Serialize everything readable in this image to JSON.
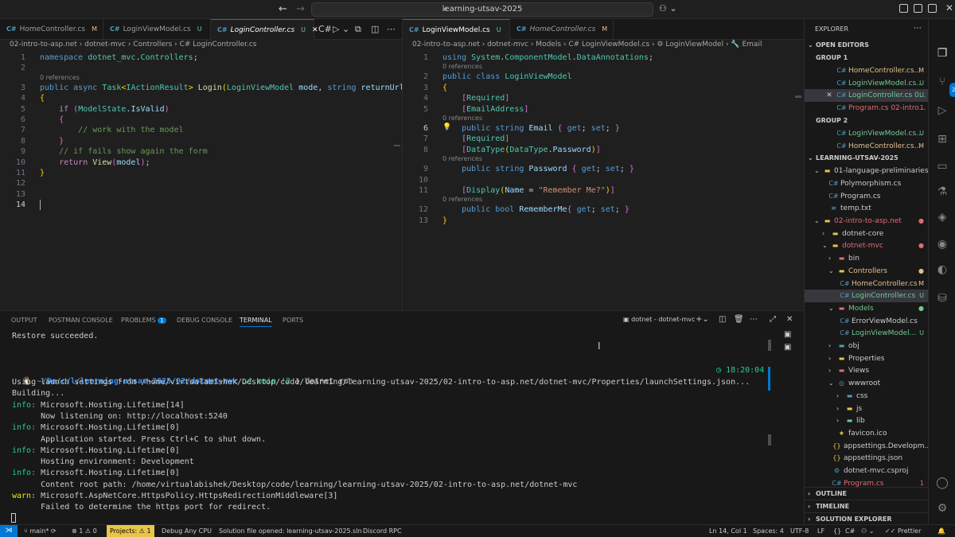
{
  "window": {
    "search": "learning-utsav-2025"
  },
  "left_editor": {
    "tabs": [
      {
        "label": "HomeController.cs",
        "mark": "M"
      },
      {
        "label": "LoginViewModel.cs",
        "mark": "U"
      },
      {
        "label": "LoginController.cs",
        "mark": "U"
      }
    ],
    "breadcrumb": "02-intro-to-asp.net  ›  dotnet-mvc  ›  Controllers  ›  C# LoginController.cs",
    "lines": [
      {
        "n": "1",
        "html": "<span class=\"kw\">namespace</span> <span class=\"ty\">dotnet_mvc</span>.<span class=\"ty\">Controllers</span>;"
      },
      {
        "n": "2",
        "html": ""
      },
      {
        "n": "3",
        "html": "<span class=\"kw\">public</span> <span class=\"kw\">async</span> <span class=\"ty\">Task</span><span class=\"br\">&lt;</span><span class=\"ty\">IActionResult</span><span class=\"br\">&gt;</span> <span class=\"fn\">Login</span><span class=\"br\">(</span><span class=\"ty\">LoginViewModel</span> <span class=\"pl\">mode</span>, <span class=\"kw\">string</span> <span class=\"pl\">returnUrl</span>"
      },
      {
        "n": "4",
        "html": "<span class=\"br\">{</span>"
      },
      {
        "n": "5",
        "html": "    <span class=\"ctl\">if</span> <span class=\"br2\">(</span><span class=\"ty\">ModelState</span>.<span class=\"pl\">IsValid</span><span class=\"br2\">)</span>"
      },
      {
        "n": "6",
        "html": "    <span class=\"br2\">{</span>"
      },
      {
        "n": "7",
        "html": "        <span class=\"cm\">// work with the model</span>"
      },
      {
        "n": "8",
        "html": "    <span class=\"br2\">}</span>"
      },
      {
        "n": "9",
        "html": "    <span class=\"cm\">// if fails show again the form</span>"
      },
      {
        "n": "10",
        "html": "    <span class=\"ctl\">return</span> <span class=\"fn\">View</span><span class=\"br2\">(</span><span class=\"pl\">model</span><span class=\"br2\">)</span>;"
      },
      {
        "n": "11",
        "html": "<span class=\"br\">}</span>"
      },
      {
        "n": "12",
        "html": ""
      },
      {
        "n": "13",
        "html": ""
      },
      {
        "n": "14",
        "html": ""
      }
    ],
    "lens": "0 references"
  },
  "right_editor": {
    "tabs": [
      {
        "label": "LoginViewModel.cs",
        "mark": "U"
      },
      {
        "label": "HomeController.cs",
        "mark": "M"
      }
    ],
    "breadcrumb": "02-intro-to-asp.net  ›  dotnet-mvc  ›  Models  ›  C# LoginViewModel.cs  ›  ⚙ LoginViewModel  ›  🔧 Email",
    "lines": [
      {
        "n": "1",
        "html": "<span class=\"kw\">using</span> <span class=\"ty\">System</span>.<span class=\"ty\">ComponentModel</span>.<span class=\"ty\">DataAnnotations</span>;"
      },
      {
        "n": "2",
        "html": "<span class=\"kw\">public</span> <span class=\"kw\">class</span> <span class=\"ty\">LoginViewModel</span>"
      },
      {
        "n": "3",
        "html": "<span class=\"br\">{</span>"
      },
      {
        "n": "4",
        "html": "    <span class=\"br2\">[</span><span class=\"at\">Required</span><span class=\"br2\">]</span>"
      },
      {
        "n": "5",
        "html": "    <span class=\"br2\">[</span><span class=\"at\">EmailAddress</span><span class=\"br2\">]</span>"
      },
      {
        "n": "6",
        "html": "    <span class=\"kw\">public</span> <span class=\"kw\">string</span> <span class=\"pl\">Email</span> <span class=\"br2\">{</span> <span class=\"kw\">get</span>; <span class=\"kw\">set</span>; <span class=\"br2\">}</span>"
      },
      {
        "n": "7",
        "html": "    <span class=\"br2\">[</span><span class=\"at\">Required</span><span class=\"br2\">]</span>"
      },
      {
        "n": "8",
        "html": "    <span class=\"br2\">[</span><span class=\"at\">DataType</span><span class=\"br\">(</span><span class=\"ty\">DataType</span>.<span class=\"pl\">Password</span><span class=\"br\">)</span><span class=\"br2\">]</span>"
      },
      {
        "n": "9",
        "html": "    <span class=\"kw\">public</span> <span class=\"kw\">string</span> <span class=\"pl\">Password</span> <span class=\"br2\">{</span> <span class=\"kw\">get</span>; <span class=\"kw\">set</span>; <span class=\"br2\">}</span>"
      },
      {
        "n": "10",
        "html": ""
      },
      {
        "n": "11",
        "html": "    <span class=\"br2\">[</span><span class=\"at\">Display</span><span class=\"br\">(</span><span class=\"pl\">Name</span> = <span class=\"st\">\"Remember Me?\"</span><span class=\"br\">)</span><span class=\"br2\">]</span>"
      },
      {
        "n": "12",
        "html": "    <span class=\"kw\">public</span> <span class=\"kw\">bool</span> <span class=\"pl\">RememberMe</span><span class=\"br2\">{</span> <span class=\"kw\">get</span>; <span class=\"kw\">set</span>; <span class=\"br2\">}</span>"
      },
      {
        "n": "13",
        "html": "<span class=\"br\">}</span>"
      }
    ],
    "lens": "0 references"
  },
  "explorer": {
    "title": "EXPLORER",
    "open_editors": "OPEN EDITORS",
    "group1": "GROUP 1",
    "group2": "GROUP 2",
    "workspace": "LEARNING-UTSAV-2025",
    "rows": [
      {
        "kind": "file",
        "indent": 40,
        "icon": "C#",
        "label": "HomeController.cs...",
        "stat": "M",
        "cls": "c-mod",
        "lcls": "c-mod"
      },
      {
        "kind": "file",
        "indent": 40,
        "icon": "C#",
        "label": "LoginViewModel.cs...",
        "stat": "U",
        "cls": "c-grn",
        "lcls": "c-grn"
      },
      {
        "kind": "file",
        "indent": 40,
        "icon": "C#",
        "label": "LoginController.cs 0...",
        "stat": "U",
        "cls": "c-grn",
        "lcls": "c-grn",
        "sel": true,
        "close": true
      },
      {
        "kind": "file",
        "indent": 40,
        "icon": "C#",
        "label": "Program.cs  02-intro...",
        "stat": "1",
        "cls": "c-red",
        "lcls": "c-red"
      },
      {
        "kind": "grp2"
      },
      {
        "kind": "file",
        "indent": 40,
        "icon": "C#",
        "label": "LoginViewModel.cs...",
        "stat": "U",
        "cls": "c-grn",
        "lcls": "c-grn"
      },
      {
        "kind": "file",
        "indent": 40,
        "icon": "C#",
        "label": "HomeController.cs...",
        "stat": "M",
        "cls": "c-mod",
        "lcls": "c-mod"
      },
      {
        "kind": "ws"
      },
      {
        "kind": "folder",
        "indent": 12,
        "chev": "⌄",
        "icon": "▬",
        "icls": "c-yel",
        "label": "01-language-preliminaries"
      },
      {
        "kind": "file",
        "indent": 30,
        "icon": "C#",
        "label": "Polymorphism.cs"
      },
      {
        "kind": "file",
        "indent": 30,
        "icon": "C#",
        "label": "Program.cs"
      },
      {
        "kind": "file",
        "indent": 30,
        "icon": "≡",
        "icls": "c-blue",
        "label": "temp.txt"
      },
      {
        "kind": "folder",
        "indent": 12,
        "chev": "⌄",
        "icon": "▬",
        "icls": "c-yel",
        "label": "02-intro-to-asp.net",
        "lcls": "c-red",
        "dot": true
      },
      {
        "kind": "folder",
        "indent": 22,
        "chev": "›",
        "icon": "▬",
        "icls": "c-yel",
        "label": "dotnet-core"
      },
      {
        "kind": "folder",
        "indent": 22,
        "chev": "⌄",
        "icon": "▬",
        "icls": "c-yel",
        "label": "dotnet-mvc",
        "lcls": "c-red",
        "dot": true
      },
      {
        "kind": "folder",
        "indent": 30,
        "chev": "›",
        "icon": "▬",
        "icls": "c-red",
        "label": "bin"
      },
      {
        "kind": "folder",
        "indent": 30,
        "chev": "⌄",
        "icon": "▬",
        "icls": "c-yel",
        "label": "Controllers",
        "lcls": "c-mod",
        "dot": true
      },
      {
        "kind": "file",
        "indent": 44,
        "icon": "C#",
        "label": "HomeController.cs",
        "stat": "M",
        "cls": "c-mod",
        "lcls": "c-mod"
      },
      {
        "kind": "file",
        "indent": 44,
        "icon": "C#",
        "label": "LoginController.cs",
        "stat": "U",
        "cls": "c-grn",
        "lcls": "c-grn",
        "sel": true
      },
      {
        "kind": "folder",
        "indent": 30,
        "chev": "⌄",
        "icon": "▬",
        "icls": "c-red",
        "label": "Models",
        "lcls": "c-grn",
        "dot": true
      },
      {
        "kind": "file",
        "indent": 44,
        "icon": "C#",
        "label": "ErrorViewModel.cs"
      },
      {
        "kind": "file",
        "indent": 44,
        "icon": "C#",
        "label": "LoginViewModel...",
        "stat": "U",
        "cls": "c-grn",
        "lcls": "c-grn"
      },
      {
        "kind": "folder",
        "indent": 30,
        "chev": "›",
        "icon": "▬",
        "icls": "c-blue",
        "label": "obj"
      },
      {
        "kind": "folder",
        "indent": 30,
        "chev": "›",
        "icon": "▬",
        "icls": "c-yel",
        "label": "Properties"
      },
      {
        "kind": "folder",
        "indent": 30,
        "chev": "›",
        "icon": "▬",
        "icls": "c-red",
        "label": "Views"
      },
      {
        "kind": "folder",
        "indent": 30,
        "chev": "⌄",
        "icon": "◎",
        "icls": "c-blue",
        "label": "wwwroot"
      },
      {
        "kind": "folder",
        "indent": 40,
        "chev": "›",
        "icon": "▬",
        "icls": "c-blue",
        "label": "css"
      },
      {
        "kind": "folder",
        "indent": 40,
        "chev": "›",
        "icon": "▬",
        "icls": "c-yel",
        "label": "js"
      },
      {
        "kind": "folder",
        "indent": 40,
        "chev": "›",
        "icon": "▬",
        "icls": "c-grn",
        "label": "lib"
      },
      {
        "kind": "file",
        "indent": 40,
        "icon": "★",
        "icls": "c-yel",
        "label": "favicon.ico"
      },
      {
        "kind": "file",
        "indent": 34,
        "icon": "{}",
        "icls": "c-yel",
        "label": "appsettings.Developm..."
      },
      {
        "kind": "file",
        "indent": 34,
        "icon": "{}",
        "icls": "c-yel",
        "label": "appsettings.json"
      },
      {
        "kind": "file",
        "indent": 34,
        "icon": "⚙",
        "icls": "c-blue",
        "label": "dotnet-mvc.csproj"
      },
      {
        "kind": "file",
        "indent": 34,
        "icon": "C#",
        "label": "Program.cs",
        "stat": "1",
        "cls": "c-red",
        "lcls": "c-red"
      }
    ],
    "outline": "OUTLINE",
    "timeline": "TIMELINE",
    "solution_explorer": "SOLUTION EXPLORER"
  },
  "panel": {
    "tabs": [
      "OUTPUT",
      "POSTMAN CONSOLE",
      "PROBLEMS",
      "DEBUG CONSOLE",
      "TERMINAL",
      "PORTS"
    ],
    "problems_count": "1",
    "terminal_name": "dotnet - dotnet-mvc",
    "restore": "Restore succeeded.",
    "prompt_path": "~/De/c/l/learning-utsav-2025/02/dotnet-mvc",
    "prompt_git": "main !2",
    "prompt_cmd": "dotnet run",
    "prompt_time": "18:20:04",
    "output": [
      {
        "tag": "",
        "text": "Using launch settings from /home/virtualabishek/Desktop/code/learning/learning-utsav-2025/02-intro-to-asp.net/dotnet-mvc/Properties/launchSettings.json..."
      },
      {
        "tag": "",
        "text": "Building..."
      },
      {
        "tag": "info",
        "text": "Microsoft.Hosting.Lifetime[14]"
      },
      {
        "tag": "",
        "text": "      Now listening on: http://localhost:5240"
      },
      {
        "tag": "info",
        "text": "Microsoft.Hosting.Lifetime[0]"
      },
      {
        "tag": "",
        "text": "      Application started. Press Ctrl+C to shut down."
      },
      {
        "tag": "info",
        "text": "Microsoft.Hosting.Lifetime[0]"
      },
      {
        "tag": "",
        "text": "      Hosting environment: Development"
      },
      {
        "tag": "info",
        "text": "Microsoft.Hosting.Lifetime[0]"
      },
      {
        "tag": "",
        "text": "      Content root path: /home/virtualabishek/Desktop/code/learning/learning-utsav-2025/02-intro-to-asp.net/dotnet-mvc"
      },
      {
        "tag": "warn",
        "text": "Microsoft.AspNetCore.HttpsPolicy.HttpsRedirectionMiddleware[3]"
      },
      {
        "tag": "",
        "text": "      Failed to determine the https port for redirect."
      }
    ]
  },
  "status": {
    "branch": "main*",
    "errors": "1",
    "warnings": "0",
    "projects": "Projects: ⚠ 1",
    "debug": "Debug Any CPU",
    "solution": "Solution file opened: learning-utsav-2025.sln",
    "discord": "Discord RPC",
    "position": "Ln 14, Col 1",
    "spaces": "Spaces: 4",
    "encoding": "UTF-8",
    "eol": "LF",
    "lang": "C#",
    "prettier": "Prettier"
  }
}
